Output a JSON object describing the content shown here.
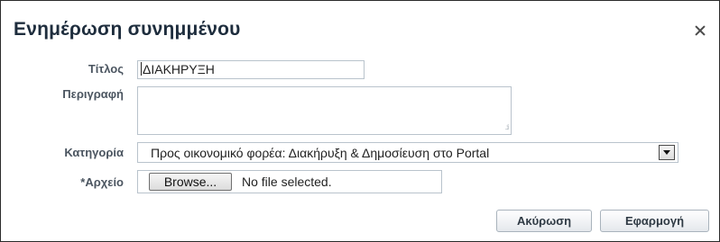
{
  "dialog": {
    "title": "Ενημέρωση συνημμένου",
    "close_icon": "close-icon"
  },
  "form": {
    "title_label": "Τίτλος",
    "title_value": "ΔΙΑΚΗΡΥΞΗ",
    "description_label": "Περιγραφή",
    "description_value": "",
    "category_label": "Κατηγορία",
    "category_value": "Προς οικονομικό φορέα: Διακήρυξη & Δημοσίευση στο Portal",
    "file_label": "*Αρχείο",
    "browse_label": "Browse...",
    "file_status": "No file selected."
  },
  "actions": {
    "cancel_label": "Ακύρωση",
    "apply_label": "Εφαρμογή"
  }
}
